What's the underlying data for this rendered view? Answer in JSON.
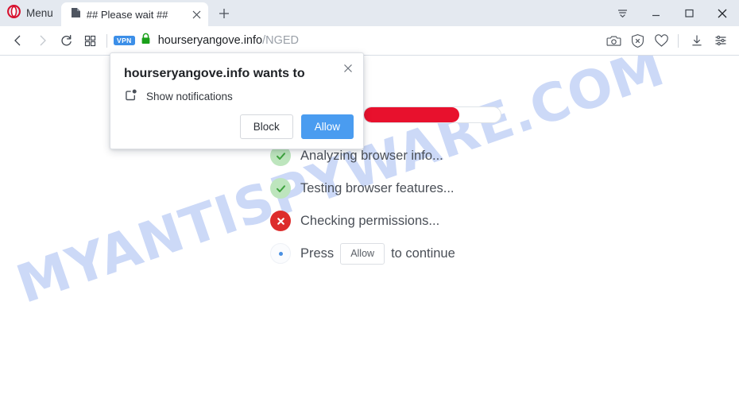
{
  "browser": {
    "menu_label": "Menu",
    "tab": {
      "title": "## Please wait ##",
      "favicon_name": "page-favicon",
      "close_label": "×"
    },
    "new_tab_label": "+",
    "window_controls": [
      {
        "name": "tab-menu-button",
        "label": "tab-list-icon"
      },
      {
        "name": "minimize-button",
        "label": "minimize-icon"
      },
      {
        "name": "maximize-button",
        "label": "maximize-icon"
      },
      {
        "name": "close-window-button",
        "label": "close-icon"
      }
    ],
    "nav": {
      "back_label": "back-icon",
      "forward_label": "forward-icon",
      "reload_label": "reload-icon",
      "speeddial_label": "speed-dial-icon",
      "vpn_badge": "VPN",
      "padlock_label": "secure-lock-icon",
      "url_domain": "hourseryangove.info",
      "url_path": "/NGED",
      "url_full": "hourseryangove.info/NGED",
      "right_icons": [
        {
          "name": "snapshot-icon",
          "label": "camera"
        },
        {
          "name": "ad-blocker-icon",
          "label": "shield-x"
        },
        {
          "name": "favorites-icon",
          "label": "heart"
        },
        {
          "name": "downloads-icon",
          "label": "download-arrow"
        },
        {
          "name": "easy-setup-icon",
          "label": "sliders"
        }
      ]
    }
  },
  "page": {
    "watermark": "MYANTISPYWARE.COM",
    "watermark_color": "#ccd9f7",
    "progress": {
      "percent": 70,
      "fill_color": "#e8112d",
      "track_color": "#ffffff"
    },
    "checks": [
      {
        "label": "Analyzing browser info...",
        "status": "ok",
        "icon": "check-icon"
      },
      {
        "label": "Testing browser features...",
        "status": "ok",
        "icon": "check-icon"
      },
      {
        "label": "Checking permissions...",
        "status": "error",
        "icon": "x-icon"
      }
    ],
    "final_row": {
      "prefix": "Press",
      "button_label": "Allow",
      "suffix": "to continue",
      "status": "pending",
      "icon": "dot-icon"
    }
  },
  "dialog": {
    "title": "hourseryangove.info wants to",
    "request_label": "Show notifications",
    "request_icon": "notification-icon",
    "close_label": "×",
    "block_label": "Block",
    "allow_label": "Allow",
    "allow_color": "#4a9cf0"
  }
}
